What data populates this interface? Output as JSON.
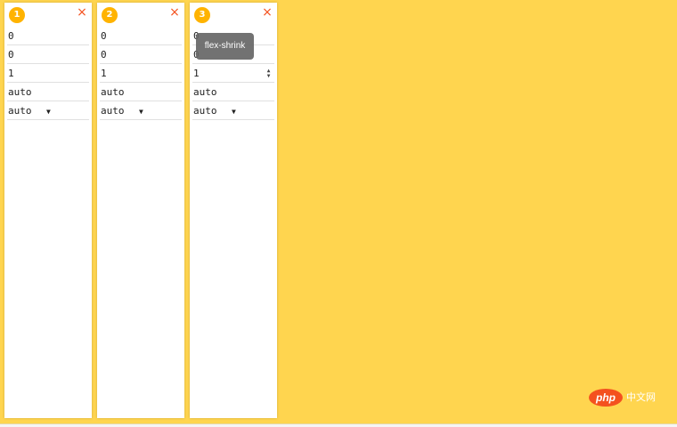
{
  "cards": [
    {
      "index": "1",
      "close_label": "×",
      "order": "0",
      "flex_grow": "0",
      "flex_shrink": "1",
      "flex_basis": "auto",
      "align_self": "auto"
    },
    {
      "index": "2",
      "close_label": "×",
      "order": "0",
      "flex_grow": "0",
      "flex_shrink": "1",
      "flex_basis": "auto",
      "align_self": "auto"
    },
    {
      "index": "3",
      "close_label": "×",
      "order": "0",
      "flex_grow": "0",
      "flex_shrink": "1",
      "flex_basis": "auto",
      "align_self": "auto"
    }
  ],
  "tooltip": {
    "text": "flex-shrink"
  },
  "watermark": {
    "logo": "php",
    "text": "中文网"
  },
  "colors": {
    "background": "#FFD54F",
    "badge": "#FFB300",
    "close": "#F4511E",
    "tooltip_bg": "#666666"
  },
  "icons": {
    "select_caret": "caret-down-icon",
    "spinner": "spinner-arrows-icon",
    "close": "close-icon"
  }
}
